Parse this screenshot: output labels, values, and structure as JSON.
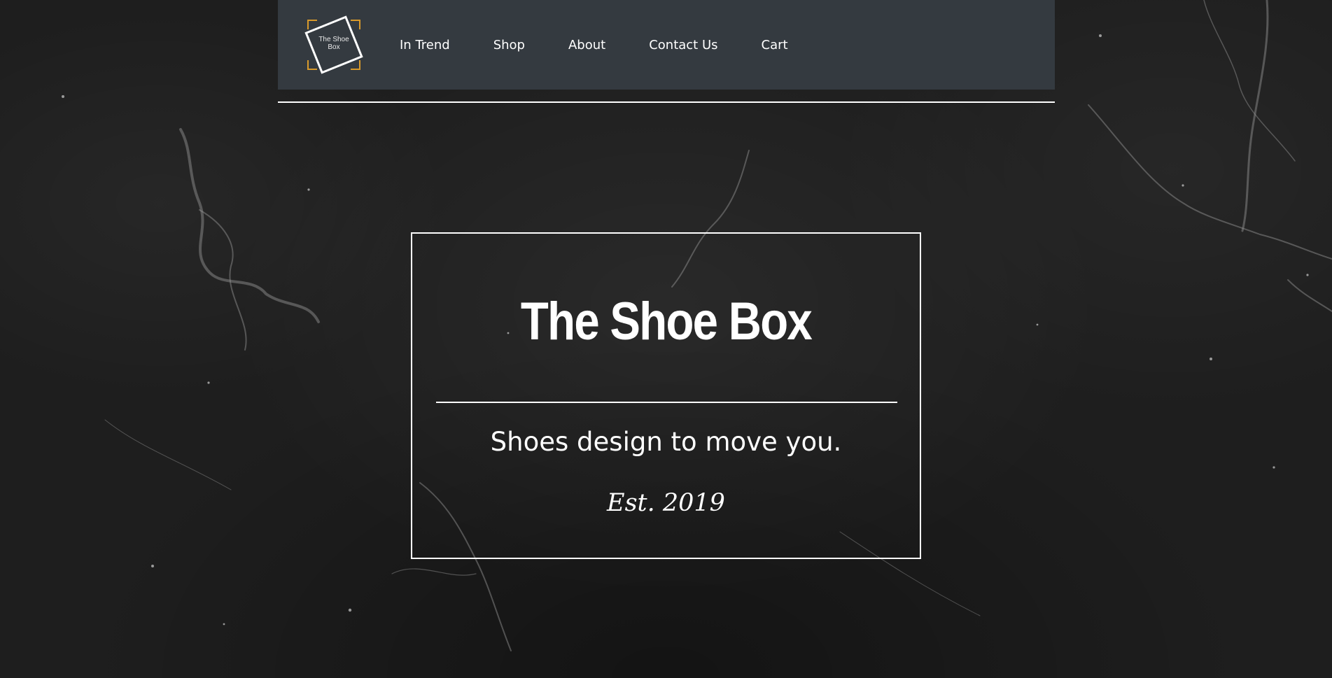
{
  "header": {
    "logo": {
      "line1": "The Shoe",
      "line2": "Box"
    },
    "nav": [
      {
        "label": "In Trend"
      },
      {
        "label": "Shop"
      },
      {
        "label": "About"
      },
      {
        "label": "Contact Us"
      },
      {
        "label": "Cart"
      }
    ]
  },
  "hero": {
    "title": "The Shoe Box",
    "tagline": "Shoes design to move you.",
    "established": "Est. 2019"
  },
  "colors": {
    "header_bg": "#343a40",
    "accent": "#d99a2b",
    "text": "#ffffff",
    "page_bg": "#1e1e1e"
  }
}
